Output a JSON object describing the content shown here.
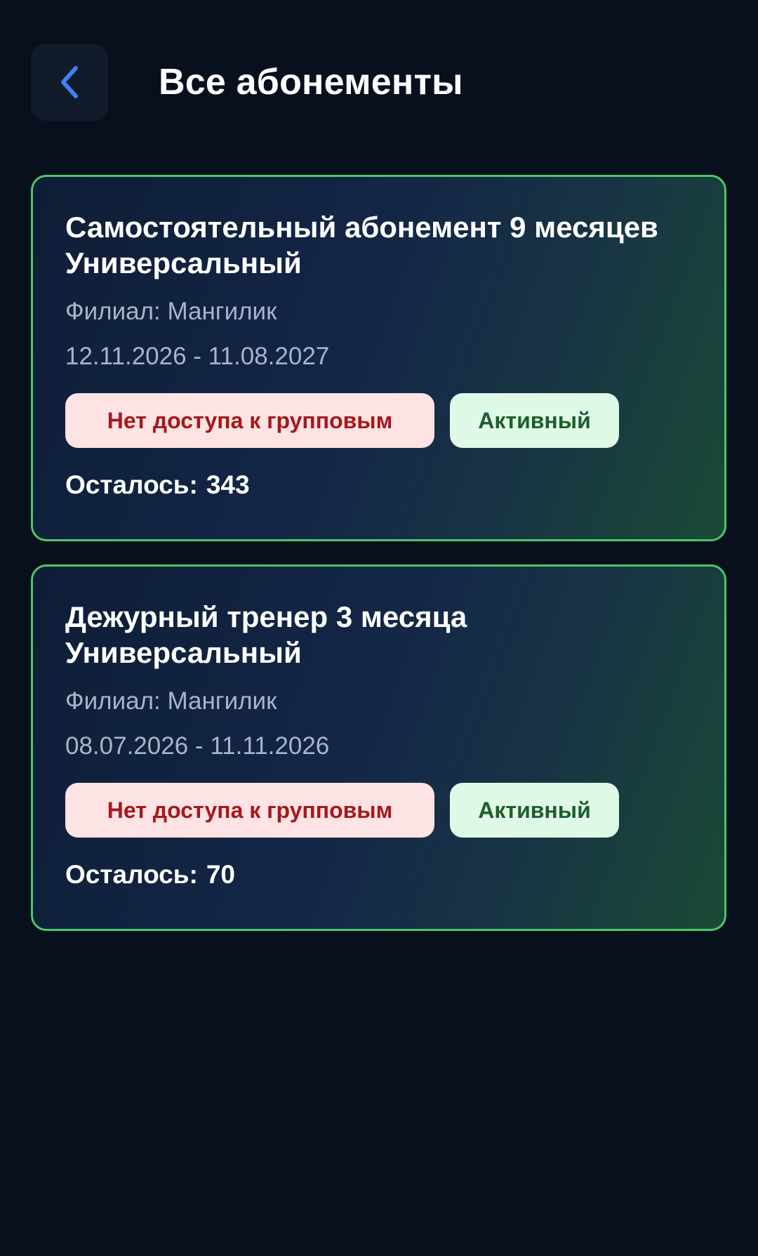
{
  "header": {
    "title": "Все абонементы",
    "back_icon": "chevron-left-icon",
    "back_icon_color": "#3b82f6"
  },
  "colors": {
    "background": "#08101d",
    "card_border": "#4cc764",
    "badge_no_access_bg": "#fde3e3",
    "badge_no_access_text": "#a3191c",
    "badge_active_bg": "#def9e6",
    "badge_active_text": "#1e5e2c",
    "secondary_text": "#a9b4c8"
  },
  "subscriptions": [
    {
      "title": "Самостоятельный абонемент 9 месяцев Универсальный",
      "branch": "Филиал: Мангилик",
      "dates": "12.11.2026 - 11.08.2027",
      "access_badge": "Нет доступа к групповым",
      "status_badge": "Активный",
      "remaining_label": "Осталось:",
      "remaining_value": "343"
    },
    {
      "title": "Дежурный тренер 3 месяца Универсальный",
      "branch": "Филиал: Мангилик",
      "dates": "08.07.2026 - 11.11.2026",
      "access_badge": "Нет доступа к групповым",
      "status_badge": "Активный",
      "remaining_label": "Осталось:",
      "remaining_value": "70"
    }
  ]
}
